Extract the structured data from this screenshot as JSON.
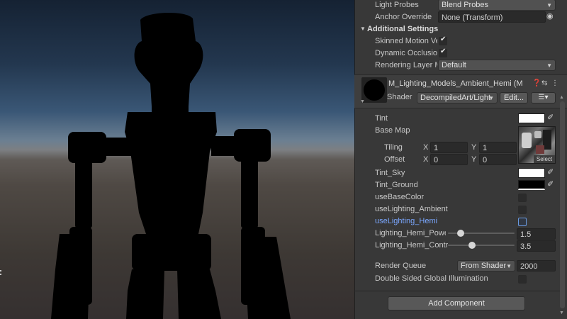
{
  "inspector": {
    "light_probes": {
      "label": "Light Probes",
      "value": "Blend Probes"
    },
    "anchor_override": {
      "label": "Anchor Override",
      "value": "None (Transform)"
    },
    "additional_settings": {
      "title": "Additional Settings",
      "skinned_motion": {
        "label": "Skinned Motion Ve",
        "checked": true
      },
      "dynamic_occlusion": {
        "label": "Dynamic Occlusion",
        "checked": true
      },
      "rendering_layer": {
        "label": "Rendering Layer M",
        "value": "Default"
      }
    },
    "material": {
      "name": "M_Lighting_Models_Ambient_Hemi (M",
      "shader_label": "Shader",
      "shader_value": "DecompiledArt/Light",
      "edit_label": "Edit...",
      "icons": {
        "help": "help-icon",
        "presets": "presets-icon",
        "more": "more-icon",
        "list": "list-icon"
      }
    },
    "properties": {
      "tint": {
        "label": "Tint",
        "color": "#ffffff"
      },
      "base_map": {
        "label": "Base Map",
        "select": "Select"
      },
      "tiling": {
        "label": "Tiling",
        "x_axis": "X",
        "x": "1",
        "y_axis": "Y",
        "y": "1"
      },
      "offset": {
        "label": "Offset",
        "x_axis": "X",
        "x": "0",
        "y_axis": "Y",
        "y": "0"
      },
      "tint_sky": {
        "label": "Tint_Sky",
        "color": "#ffffff"
      },
      "tint_ground": {
        "label": "Tint_Ground",
        "color": "#000000"
      },
      "use_base_color": {
        "label": "useBaseColor",
        "checked": false
      },
      "use_lighting_ambient": {
        "label": "useLighting_Ambient",
        "checked": false
      },
      "use_lighting_hemi": {
        "label": "useLighting_Hemi",
        "checked": false
      },
      "hemi_power": {
        "label": "Lighting_Hemi_Power",
        "value": "1.5",
        "fraction": 0.15
      },
      "hemi_contrast": {
        "label": "Lighting_Hemi_Contr",
        "value": "3.5",
        "fraction": 0.35
      },
      "render_queue": {
        "label": "Render Queue",
        "mode": "From Shader",
        "value": "2000"
      },
      "double_sided_gi": {
        "label": "Double Sided Global Illumination",
        "checked": false
      }
    },
    "add_component": "Add Component"
  }
}
